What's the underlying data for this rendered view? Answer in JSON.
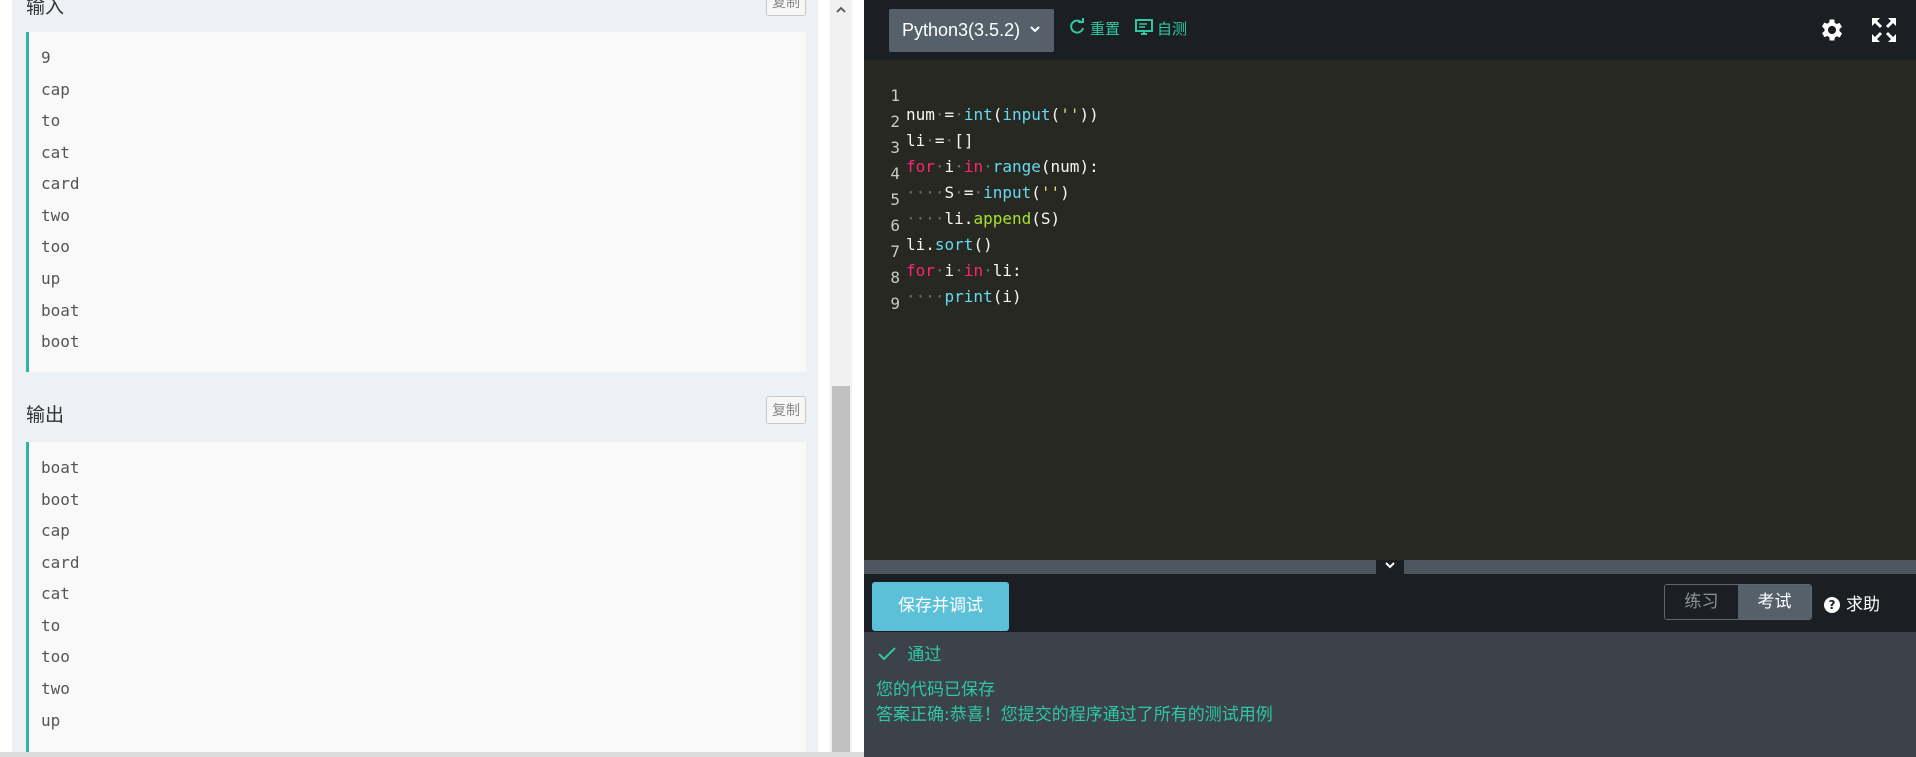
{
  "left_panel": {
    "input_section": {
      "title": "输入",
      "copy_label": "复制",
      "lines": [
        "9",
        "cap",
        "to",
        "cat",
        "card",
        "two",
        "too",
        "up",
        "boat",
        "boot"
      ]
    },
    "output_section": {
      "title": "输出",
      "copy_label": "复制",
      "lines": [
        "boat",
        "boot",
        "cap",
        "card",
        "cat",
        "to",
        "too",
        "two",
        "up"
      ]
    },
    "scrollbar": {
      "up_icon": "chevron-up-icon"
    }
  },
  "toolbar": {
    "language": "Python3(3.5.2)",
    "reset_label": "重置",
    "selftest_label": "自测",
    "icons": [
      "refresh-icon",
      "monitor-icon",
      "gear-icon",
      "expand-icon",
      "chevron-down-icon"
    ]
  },
  "editor": {
    "line_numbers": [
      "1",
      "2",
      "3",
      "4",
      "5",
      "6",
      "7",
      "8",
      "9"
    ],
    "lines": [
      "num = int(input(''))",
      "li = []",
      "for i in range(num):",
      "    S = input('')",
      "    li.append(S)",
      "li.sort()",
      "for i in li:",
      "    print(i)",
      ""
    ]
  },
  "actions": {
    "save_label": "保存并调试",
    "mode_practice": "练习",
    "mode_exam": "考试",
    "help_label": "求助",
    "help_icon": "question-icon"
  },
  "results": {
    "status": "通过",
    "saved_msg": "您的代码已保存",
    "correct_msg": "答案正确:恭喜！您提交的程序通过了所有的测试用例"
  },
  "colors": {
    "accent": "#2fc7a4",
    "save_button": "#5bc0d8",
    "editor_bg": "#272822",
    "sample_border": "#2fb4a8"
  }
}
